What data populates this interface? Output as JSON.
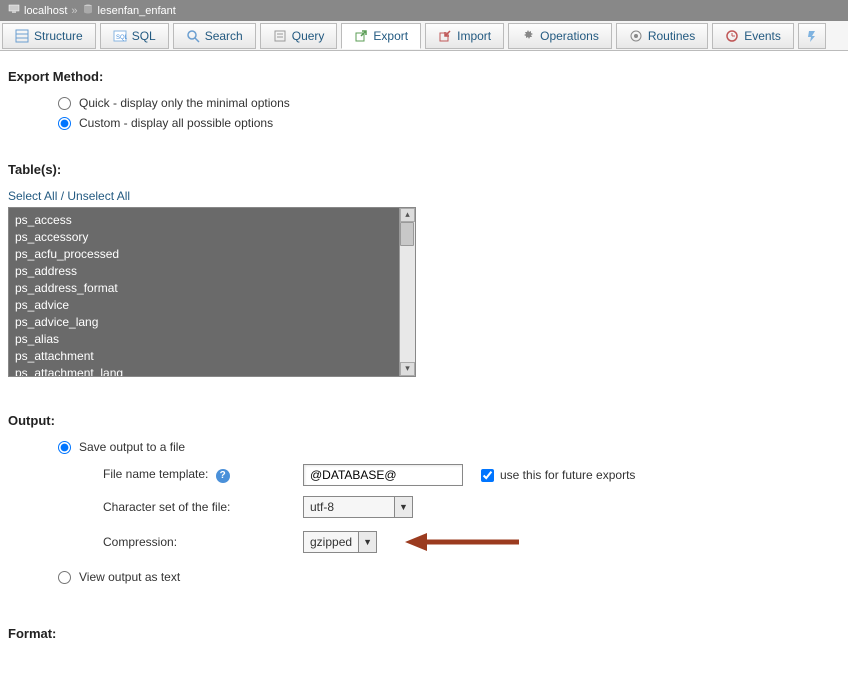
{
  "breadcrumb": {
    "server": "localhost",
    "sep": "»",
    "db": "lesenfan_enfant"
  },
  "tabs": {
    "structure": "Structure",
    "sql": "SQL",
    "search": "Search",
    "query": "Query",
    "export": "Export",
    "import": "Import",
    "operations": "Operations",
    "routines": "Routines",
    "events": "Events"
  },
  "export_method": {
    "title": "Export Method:",
    "quick": "Quick - display only the minimal options",
    "custom": "Custom - display all possible options"
  },
  "tables_section": {
    "title": "Table(s):",
    "select_links": "Select All / Unselect All",
    "items": [
      "ps_access",
      "ps_accessory",
      "ps_acfu_processed",
      "ps_address",
      "ps_address_format",
      "ps_advice",
      "ps_advice_lang",
      "ps_alias",
      "ps_attachment",
      "ps_attachment_lang"
    ]
  },
  "output": {
    "title": "Output:",
    "save_file": "Save output to a file",
    "file_template_label": "File name template:",
    "file_template_value": "@DATABASE@",
    "use_future": "use this for future exports",
    "charset_label": "Character set of the file:",
    "charset_value": "utf-8",
    "compression_label": "Compression:",
    "compression_value": "gzipped",
    "view_as_text": "View output as text"
  },
  "format": {
    "title": "Format:"
  }
}
